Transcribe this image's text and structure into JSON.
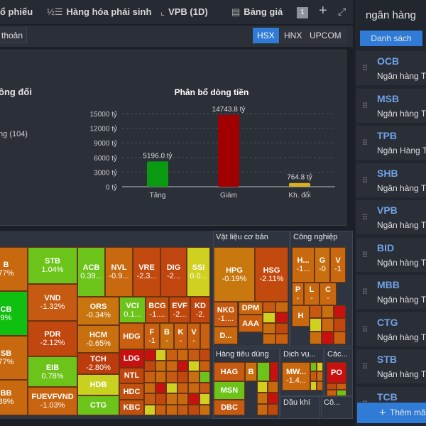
{
  "tabs": [
    {
      "icon": "",
      "label": "ổ phiếu"
    },
    {
      "icon": "1/2",
      "label": "Hàng hóa phái sinh"
    },
    {
      "icon": "chart",
      "label": "VPB (1D)"
    },
    {
      "icon": "table",
      "label": "Bảng giá"
    }
  ],
  "tab_count": "1",
  "account_button": "thoản",
  "exchanges": [
    "HSX",
    "HNX",
    "UPCOM"
  ],
  "exchange_selected": "HSX",
  "left_chart": {
    "title_partial": "ông đối",
    "legend_partial": "ng (104)"
  },
  "chart_data": {
    "type": "bar",
    "title": "Phân bổ dòng tiền",
    "categories": [
      "Tăng",
      "Giảm",
      "Kh. đổi"
    ],
    "values": [
      5196.0,
      14743.8,
      764.8
    ],
    "data_labels": [
      "5196.0 tỷ",
      "14743.8 tỷ",
      "764.8 tỷ"
    ],
    "colors": [
      "#0a9a12",
      "#a00000",
      "#d8b020"
    ],
    "ylim": [
      0,
      15000
    ],
    "yticks": [
      "0 tỷ",
      "3000 tỷ",
      "6000 tỷ",
      "9000 tỷ",
      "12000 tỷ",
      "15000 tỷ"
    ],
    "grid": true
  },
  "sectors": [
    "Vật liệu cơ bản",
    "Công nghiệp",
    "Hàng tiêu dùng",
    "Dịch vụ...",
    "Các...",
    "Dầu khí",
    "Cô..."
  ],
  "tiles": [
    [
      "B",
      "77%",
      "#c8690f"
    ],
    [
      "CB",
      "9%",
      "#10c010"
    ],
    [
      "SB",
      "77%",
      "#c8690f"
    ],
    [
      "BB",
      "89%",
      "#c8690f"
    ],
    [
      "STB",
      "1.04%",
      "#6cc41a"
    ],
    [
      "VND",
      "-1.32%",
      "#c65a12"
    ],
    [
      "PDR",
      "-2.12%",
      "#c0470e"
    ],
    [
      "EIB",
      "0.78%",
      "#6cc41a"
    ],
    [
      "FUEVFVND",
      "-1.03%",
      "#c8640f"
    ],
    [
      "ACB",
      "0.39...",
      "#6cc41a"
    ],
    [
      "NVL",
      "-0.9...",
      "#c8690f"
    ],
    [
      "VRE",
      "-2.3...",
      "#c24a0e"
    ],
    [
      "DIG",
      "-2...",
      "#c0450e"
    ],
    [
      "SSI",
      "0.0...",
      "#cfd020"
    ],
    [
      "ORS",
      "-0.34%",
      "#c8740f"
    ],
    [
      "HCM",
      "-0.65%",
      "#c8700f"
    ],
    [
      "TCH",
      "-2.80%",
      "#bc3c0e"
    ],
    [
      "HDB",
      "",
      "#c8d020"
    ],
    [
      "CTG",
      "",
      "#6cc41a"
    ],
    [
      "VCI",
      "0.1...",
      "#6cc41a"
    ],
    [
      "BCG",
      "-1....",
      "#c24f0e"
    ],
    [
      "EVF",
      "-2...",
      "#c0470e"
    ],
    [
      "KD",
      "-2.",
      "#c0450e"
    ],
    [
      "HDG",
      "",
      "#c8600f"
    ],
    [
      "F",
      "-1",
      "#c8600f"
    ],
    [
      "B",
      "-",
      "#c8700f"
    ],
    [
      "K",
      "-",
      "#c8600f"
    ],
    [
      "V",
      "-",
      "#c8600f"
    ],
    [
      "",
      "",
      "#c8600f"
    ],
    [
      "LDG",
      "",
      "#c81010"
    ],
    [
      "NTL",
      "",
      "#c0450e"
    ],
    [
      "HDC",
      "",
      "#c0500e"
    ],
    [
      "KBC",
      "",
      "#c0500e"
    ],
    [
      "HPG",
      "-0.19%",
      "#c8780f"
    ],
    [
      "HSG",
      "-2.11%",
      "#c24a0e"
    ],
    [
      "NKG",
      "-1....",
      "#c65a12"
    ],
    [
      "D...",
      "",
      "#c8690f"
    ],
    [
      "DPM",
      "",
      "#c8690f"
    ],
    [
      "AAA",
      "",
      "#c8600f"
    ],
    [
      "H...",
      "-1...",
      "#c8690f"
    ],
    [
      "G",
      "-0",
      "#c8700f"
    ],
    [
      "V",
      "-1",
      "#c8690f"
    ],
    [
      "P",
      "-",
      "#c8690f"
    ],
    [
      "L",
      "-",
      "#c8690f"
    ],
    [
      "C",
      "-",
      "#c8690f"
    ],
    [
      "H",
      "",
      "#c8690f"
    ],
    [
      "HAG",
      "",
      "#c65a12"
    ],
    [
      "B",
      "",
      "#c8700f"
    ],
    [
      "",
      "",
      "#6cc41a"
    ],
    [
      "",
      "",
      "#c81010"
    ],
    [
      "MSN",
      "",
      "#6cc41a"
    ],
    [
      "DBC",
      "",
      "#c65a12"
    ],
    [
      "MW...",
      "-1.4...",
      "#c8690f"
    ],
    [
      "PO",
      "",
      "#c81010"
    ]
  ],
  "search_value": "ngân hàng",
  "list_tab": "Danh sách",
  "watchlist": [
    {
      "symbol": "OCB",
      "name": "Ngân hàng T"
    },
    {
      "symbol": "MSB",
      "name": "Ngân hàng T"
    },
    {
      "symbol": "TPB",
      "name": "Ngân Hàng T"
    },
    {
      "symbol": "SHB",
      "name": "Ngân hàng T"
    },
    {
      "symbol": "VPB",
      "name": "Ngân hàng T"
    },
    {
      "symbol": "BID",
      "name": "Ngân hàng T"
    },
    {
      "symbol": "MBB",
      "name": "Ngân hàng T"
    },
    {
      "symbol": "CTG",
      "name": "Ngân hàng T"
    },
    {
      "symbol": "STB",
      "name": "Ngân hàng T"
    },
    {
      "symbol": "TCB",
      "name": ""
    }
  ],
  "add_button": "Thêm mã"
}
